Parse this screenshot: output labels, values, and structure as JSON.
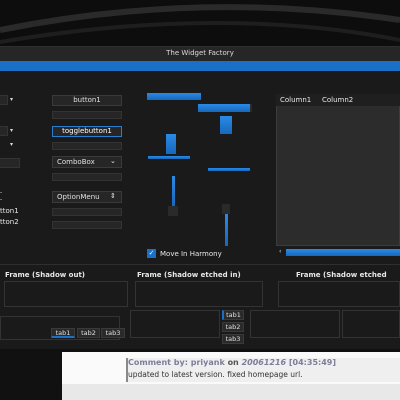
{
  "window": {
    "title": "The Widget Factory",
    "accent": "#1a6fc6"
  },
  "buttons": {
    "button1": "button1",
    "togglebutton1": "togglebutton1",
    "combobox": "ComboBox",
    "optionmenu": "OptionMenu",
    "radio1_partial": "tton1",
    "radio2_partial": "tton2"
  },
  "tree": {
    "columns": [
      "Column1",
      "Column2"
    ]
  },
  "checkbox": {
    "label": "Move In Harmony",
    "checked": true
  },
  "frames": [
    "Frame (Shadow out)",
    "Frame (Shadow etched in)",
    "Frame (Shadow etched"
  ],
  "tabs_bottom": [
    "tab1",
    "tab2",
    "tab3"
  ],
  "tabs_side": [
    "tab1",
    "tab2",
    "tab3"
  ],
  "comment": {
    "prefix": "Comment by:",
    "author": "priyank",
    "on": "on",
    "date": "20061216",
    "time": "[04:35:49]",
    "text": "updated to latest version. fixed homepage url."
  },
  "icons": {
    "combo_arrow": "chevron-down-icon",
    "option_arrow": "updown-icon",
    "check": "check-icon"
  },
  "progress": {
    "h1": 0.45,
    "h2": 0.55,
    "v1": 0.6
  }
}
